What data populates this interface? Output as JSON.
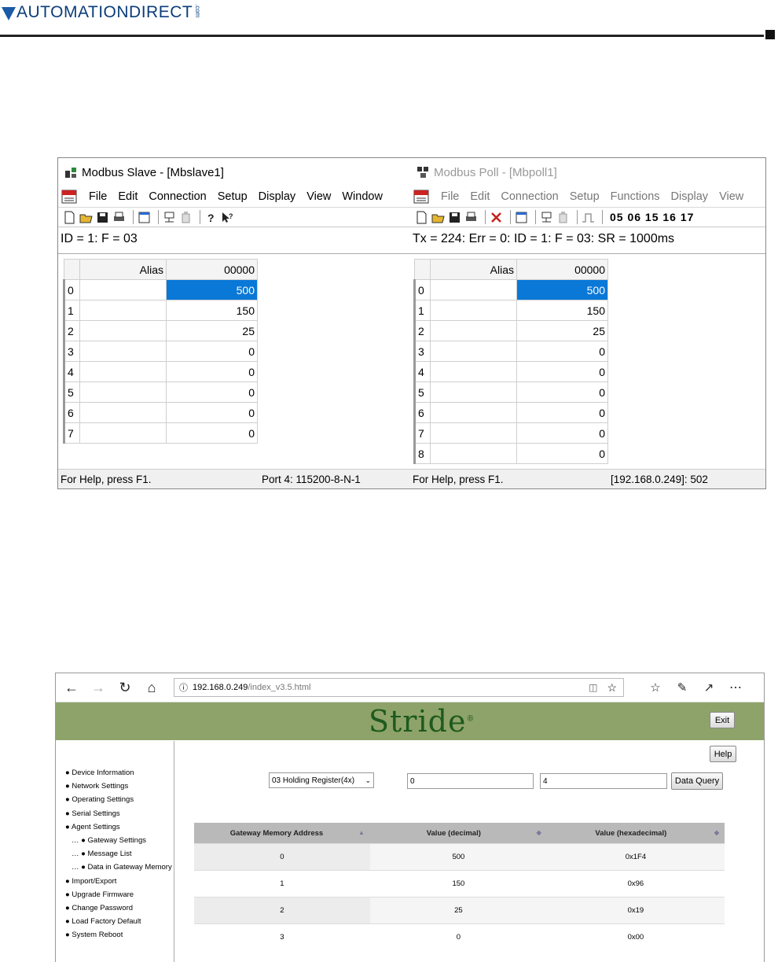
{
  "header": {
    "brand": "AUTOMATIONDIRECT",
    "brand_suffix": ".com"
  },
  "slave": {
    "title": "Modbus Slave - [Mbslave1]",
    "menu": [
      "File",
      "Edit",
      "Connection",
      "Setup",
      "Display",
      "View",
      "Window"
    ],
    "status_line": "ID = 1: F = 03",
    "col_alias": "Alias",
    "col_addr": "00000",
    "rows": [
      {
        "idx": "0",
        "val": "500"
      },
      {
        "idx": "1",
        "val": "150"
      },
      {
        "idx": "2",
        "val": "25"
      },
      {
        "idx": "3",
        "val": "0"
      },
      {
        "idx": "4",
        "val": "0"
      },
      {
        "idx": "5",
        "val": "0"
      },
      {
        "idx": "6",
        "val": "0"
      },
      {
        "idx": "7",
        "val": "0"
      }
    ],
    "help": "For Help, press F1.",
    "port": "Port 4: 115200-8-N-1"
  },
  "poll": {
    "title": "Modbus Poll - [Mbpoll1]",
    "menu": [
      "File",
      "Edit",
      "Connection",
      "Setup",
      "Functions",
      "Display",
      "View"
    ],
    "fcodes": "05 06 15 16 17",
    "status_line": "Tx = 224: Err = 0: ID = 1: F = 03: SR = 1000ms",
    "col_alias": "Alias",
    "col_addr": "00000",
    "rows": [
      {
        "idx": "0",
        "val": "500"
      },
      {
        "idx": "1",
        "val": "150"
      },
      {
        "idx": "2",
        "val": "25"
      },
      {
        "idx": "3",
        "val": "0"
      },
      {
        "idx": "4",
        "val": "0"
      },
      {
        "idx": "5",
        "val": "0"
      },
      {
        "idx": "6",
        "val": "0"
      },
      {
        "idx": "7",
        "val": "0"
      },
      {
        "idx": "8",
        "val": "0"
      }
    ],
    "help": "For Help, press F1.",
    "port": "[192.168.0.249]: 502"
  },
  "browser": {
    "url_host": "192.168.0.249",
    "url_path": "/index_v3.5.html",
    "logo": "Stride",
    "exit": "Exit",
    "help": "Help",
    "sidebar": [
      "Device Information",
      "Network Settings",
      "Operating Settings",
      "Serial Settings",
      "Agent Settings"
    ],
    "sidebar_sub": [
      "Gateway Settings",
      "Message List",
      "Data in Gateway Memory"
    ],
    "sidebar_after": [
      "Import/Export",
      "Upgrade Firmware",
      "Change Password",
      "Load Factory Default",
      "System Reboot"
    ],
    "select_value": "03 Holding Register(4x)",
    "start": "0",
    "count": "4",
    "query": "Data Query",
    "table_headers": [
      "Gateway Memory Address",
      "Value (decimal)",
      "Value (hexadecimal)"
    ],
    "table_rows": [
      [
        "0",
        "500",
        "0x1F4"
      ],
      [
        "1",
        "150",
        "0x96"
      ],
      [
        "2",
        "25",
        "0x19"
      ],
      [
        "3",
        "0",
        "0x00"
      ]
    ]
  }
}
